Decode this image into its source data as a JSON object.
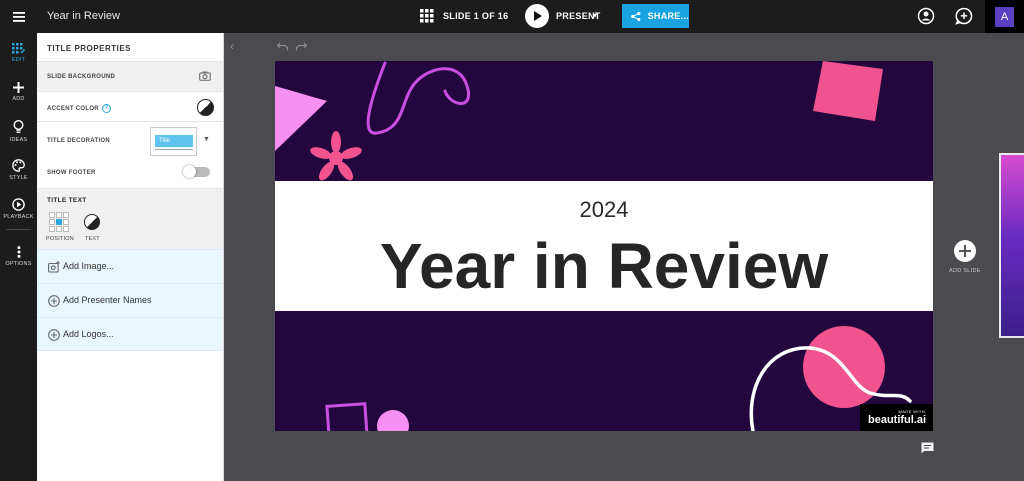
{
  "app": {
    "doc_title": "Year in Review",
    "slide_counter": "SLIDE 1 OF 16",
    "present_label": "PRESENT",
    "share_label": "SHARE...",
    "avatar_initial": "A",
    "accent_color": "#1aa3e0"
  },
  "rail": {
    "items": [
      {
        "label": "EDIT",
        "icon": "edit-grid-icon",
        "active": true
      },
      {
        "label": "ADD",
        "icon": "plus-icon"
      },
      {
        "label": "IDEAS",
        "icon": "lightbulb-icon"
      },
      {
        "label": "STYLE",
        "icon": "palette-icon"
      },
      {
        "label": "PLAYBACK",
        "icon": "play-circle-icon"
      },
      {
        "label": "OPTIONS",
        "icon": "vertical-dots-icon"
      }
    ]
  },
  "panel": {
    "title": "TITLE PROPERTIES",
    "slide_background": "SLIDE BACKGROUND",
    "accent_color": "ACCENT COLOR",
    "help_mark": "?",
    "title_decoration": "TITLE DECORATION",
    "decoration_preview": "Title",
    "show_footer": "SHOW FOOTER",
    "title_text": "TITLE TEXT",
    "position_label": "POSITION",
    "text_label": "TEXT",
    "add_image": "Add Image...",
    "add_presenter_names": "Add Presenter Names",
    "add_logos": "Add Logos..."
  },
  "slide": {
    "year": "2024",
    "title": "Year in Review",
    "background_color": "#24063f",
    "made_with": "MADE WITH",
    "brand": "beautiful.ai"
  },
  "canvas": {
    "add_slide_label": "ADD SLIDE"
  }
}
